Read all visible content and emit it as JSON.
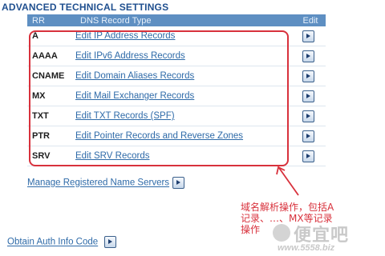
{
  "section_title": "ADVANCED TECHNICAL SETTINGS",
  "table": {
    "headers": {
      "rr": "RR",
      "type": "DNS Record Type",
      "edit": "Edit"
    },
    "rows": [
      {
        "rr": "A",
        "link": "Edit IP Address Records"
      },
      {
        "rr": "AAAA",
        "link": "Edit IPv6 Address Records"
      },
      {
        "rr": "CNAME",
        "link": "Edit Domain Aliases Records"
      },
      {
        "rr": "MX",
        "link": "Edit Mail Exchanger Records"
      },
      {
        "rr": "TXT",
        "link": "Edit TXT Records (SPF)"
      },
      {
        "rr": "PTR",
        "link": "Edit Pointer Records and Reverse Zones"
      },
      {
        "rr": "SRV",
        "link": "Edit SRV Records"
      }
    ]
  },
  "links": {
    "manage_name_servers": "Manage Registered Name Servers",
    "auth_info": "Obtain Auth Info Code"
  },
  "annotation": {
    "line1": "域名解析操作，包括A",
    "line2": "记录、…、MX等记录",
    "line3": "操作"
  },
  "watermark": {
    "brand": "便宜吧",
    "site": "www.5558.biz"
  },
  "colors": {
    "header_bg": "#5e8fc2",
    "link": "#2e6aa8",
    "annotation": "#d8313c",
    "title": "#1f4f8f"
  }
}
